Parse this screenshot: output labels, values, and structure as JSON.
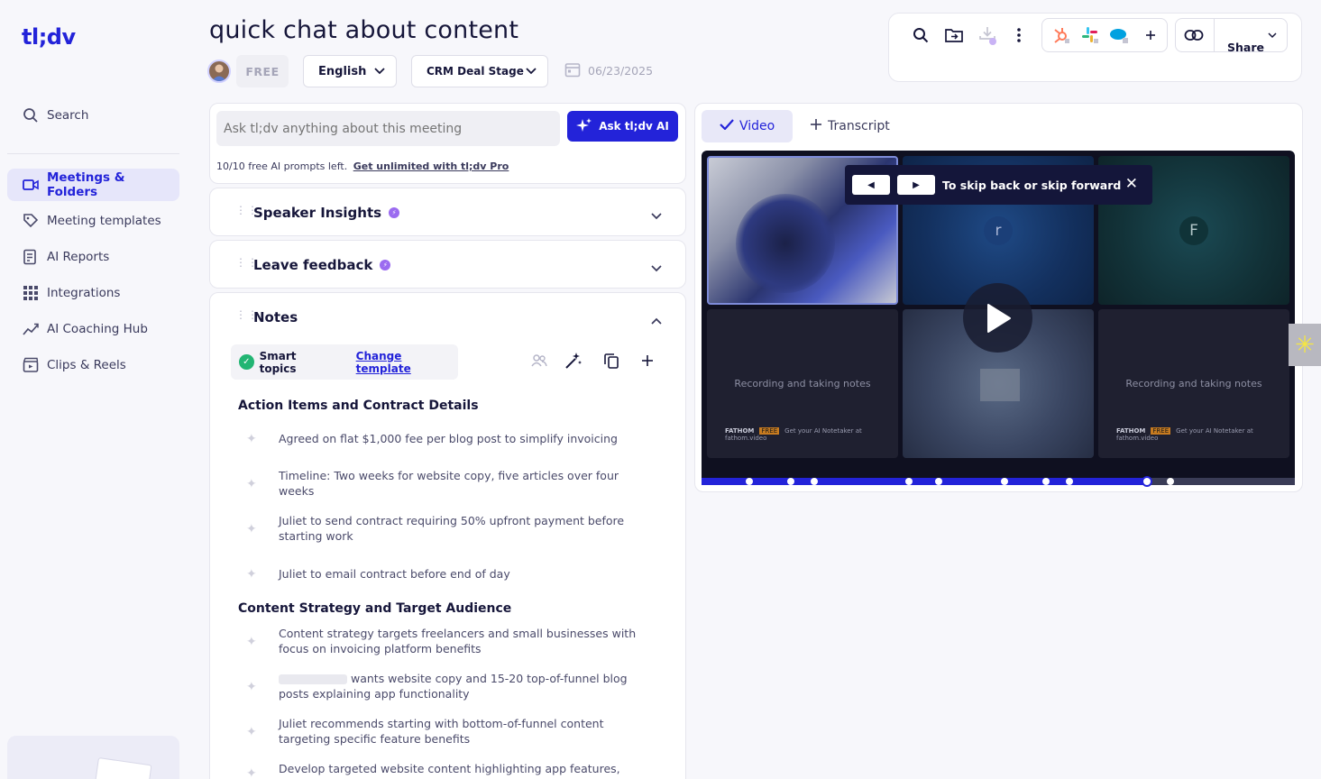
{
  "brand": {
    "logo": "tl;dv"
  },
  "sidebar": {
    "search_label": "Search",
    "items": [
      {
        "label": "Meetings & Folders",
        "icon": "video-camera-icon",
        "active": true
      },
      {
        "label": "Meeting templates",
        "icon": "template-tag-icon"
      },
      {
        "label": "AI Reports",
        "icon": "report-icon"
      },
      {
        "label": "Integrations",
        "icon": "grid-icon"
      },
      {
        "label": "AI Coaching Hub",
        "icon": "trend-chart-icon"
      },
      {
        "label": "Clips & Reels",
        "icon": "clapperboard-icon"
      }
    ]
  },
  "header": {
    "title": "quick chat about content",
    "plan_badge": "FREE",
    "language": "English",
    "crm": "CRM Deal Stage",
    "date": "06/23/2025"
  },
  "toolbar": {
    "share_label": "Share"
  },
  "ask": {
    "placeholder": "Ask tl;dv anything about this meeting",
    "button": "Ask tl;dv AI",
    "prompts_left": "10/10 free AI prompts left.",
    "upgrade_link": "Get unlimited with tl;dv Pro"
  },
  "sections": {
    "speaker_insights": "Speaker Insights",
    "leave_feedback": "Leave feedback",
    "notes": "Notes"
  },
  "notes": {
    "smart_topics": "Smart topics",
    "change_template": "Change template",
    "topics": [
      {
        "title": "Action Items and Contract Details",
        "items": [
          "Agreed on flat $1,000 fee per blog post to simplify invoicing",
          "Timeline: Two weeks for website copy, five articles over four weeks",
          "Juliet to send contract requiring 50% upfront payment before starting work",
          "Juliet to email contract before end of day"
        ]
      },
      {
        "title": "Content Strategy and Target Audience",
        "items": [
          "Content strategy targets freelancers and small businesses with focus on invoicing platform benefits",
          "wants website copy and 15-20 top-of-funnel blog posts explaining app functionality",
          "Juliet recommends starting with bottom-of-funnel content targeting specific feature benefits",
          "Develop targeted website content highlighting app features,"
        ]
      }
    ]
  },
  "media": {
    "tab_video": "Video",
    "tab_transcript": "Transcript",
    "participant_r": "r",
    "participant_f": "F",
    "recording_text": "Recording and taking notes",
    "fathom_brand": "FATHOM",
    "fathom_tag": "Get your AI Notetaker at fathom.video",
    "fathom_badge": "FREE",
    "tooltip": "To skip back or skip forward",
    "progress_fraction": 0.75
  },
  "colors": {
    "accent": "#2323d9",
    "success": "#22b573",
    "purple_badge": "#9b6bf0"
  }
}
